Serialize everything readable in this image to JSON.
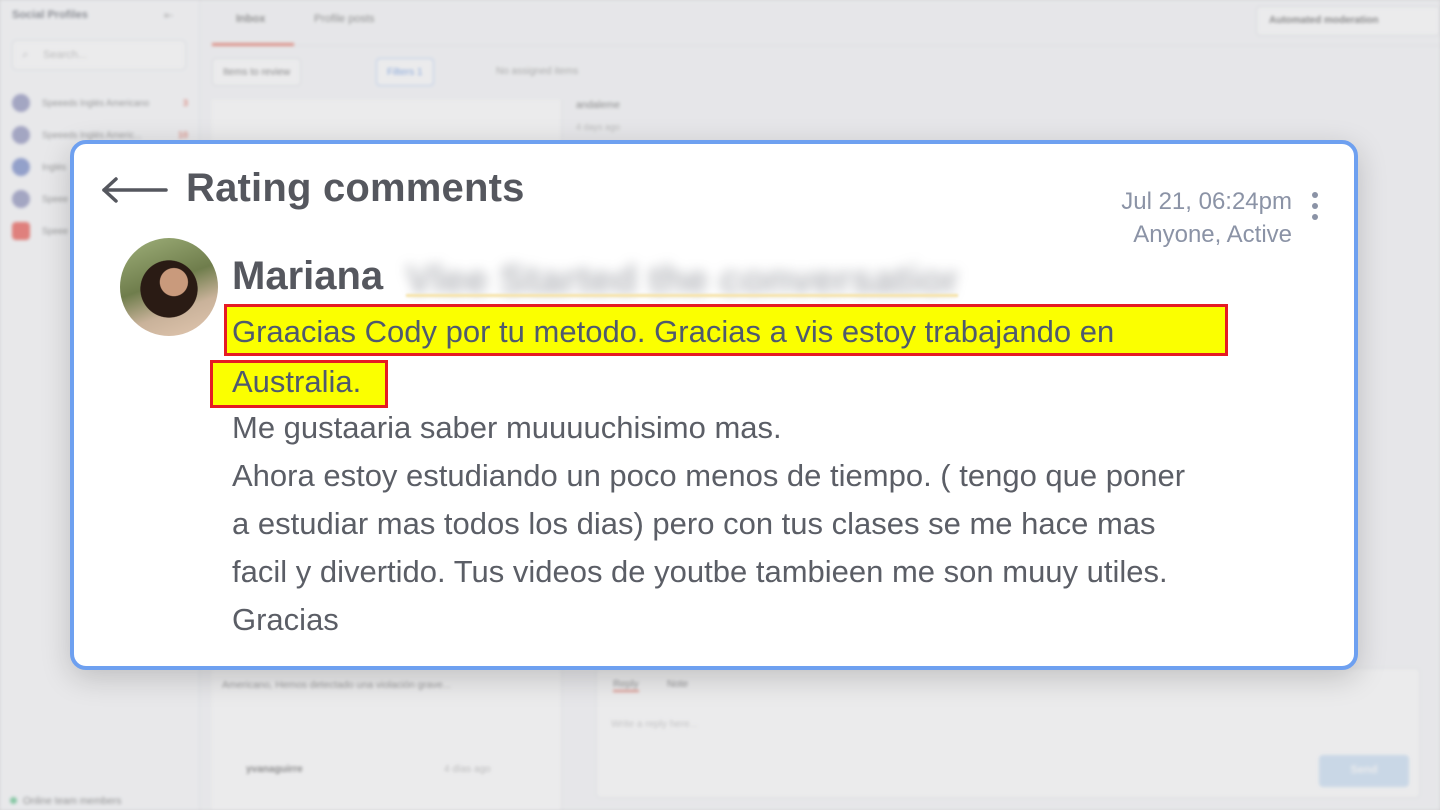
{
  "background": {
    "sidebar": {
      "title": "Social Profiles",
      "collapse_icon": "collapse-icon",
      "search_placeholder": "Search...",
      "items": [
        {
          "name": "Speeeds Inglés Americano",
          "count": "3"
        },
        {
          "name": "Speeeds Inglés Americ...",
          "count": "10"
        },
        {
          "name": "Inglés",
          "count": ""
        },
        {
          "name": "Speee",
          "count": ""
        },
        {
          "name": "Speee",
          "count": ""
        }
      ],
      "online_label": "Online team members"
    },
    "tabs": [
      {
        "label": "Inbox"
      },
      {
        "label": "Profile posts"
      }
    ],
    "automated_moderation_label": "Automated moderation",
    "toolbar": {
      "items_to_review_label": "Items to review",
      "filters_label": "Filters 1",
      "no_assigned_label": "No assigned items"
    },
    "list_items": [
      "Americano, Hemos detectado una violación grave...",
      "yvanaguirre",
      "4 días ago"
    ],
    "detail": {
      "author": "andaleme",
      "meta": "4 days ago"
    },
    "reply": {
      "tabs": [
        "Reply",
        "Note"
      ],
      "placeholder": "Write a reply here...",
      "send_label": "Send"
    }
  },
  "modal": {
    "back_icon": "arrow-left-icon",
    "title": "Rating comments",
    "timestamp": "Jul 21, 06:24pm",
    "audience": "Anyone, Active",
    "menu_icon": "kebab-menu-icon",
    "author_first_name": "Mariana",
    "author_blurred_text": "Vlee Started the conversation",
    "message_lines": [
      "Graacias Cody por tu metodo. Gracias a vis estoy trabajando en",
      "Australia.",
      "Me gustaaria saber muuuuchisimo mas.",
      "Ahora estoy estudiando un poco menos de tiempo. ( tengo que poner",
      "a estudiar mas todos los dias) pero con tus clases se me hace mas",
      "facil y divertido. Tus videos de youtbe tambieen me son muuy utiles.",
      "Gracias"
    ],
    "highlight_color": "#fbff00",
    "highlight_border_color": "#e51b24",
    "card_border_color": "#6ea0f0"
  }
}
